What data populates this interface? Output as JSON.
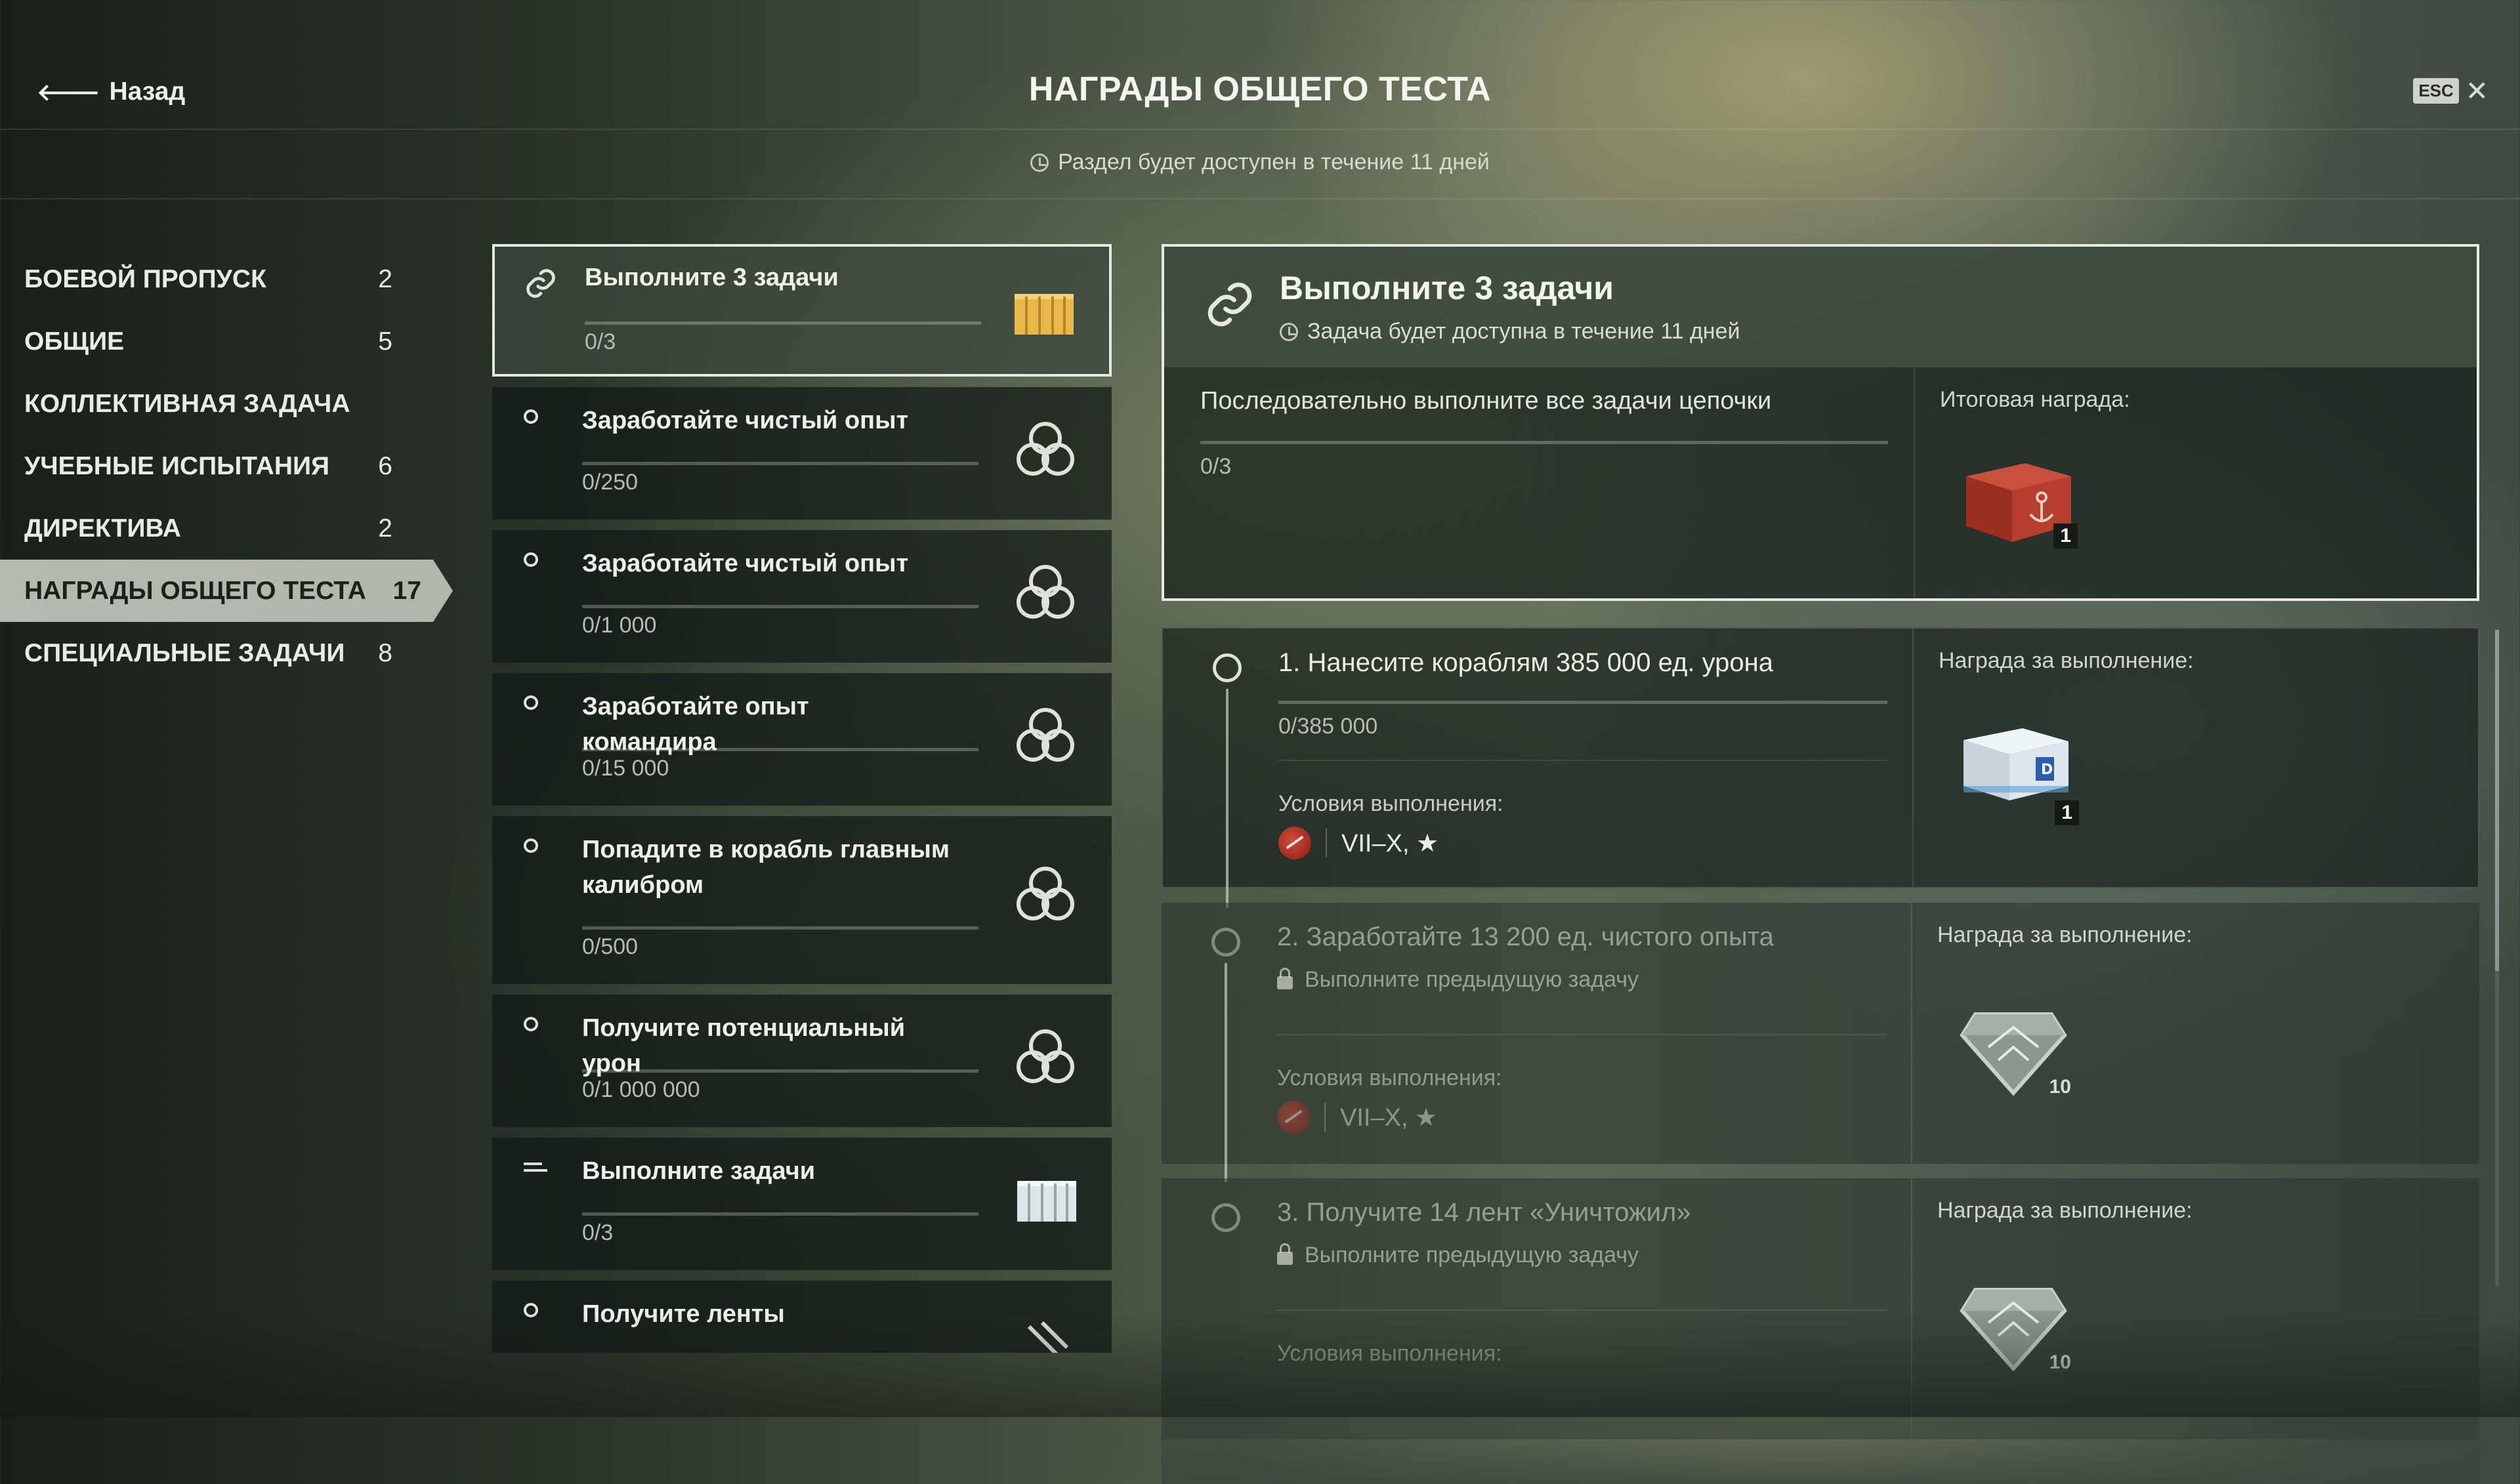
{
  "header": {
    "back_label": "Назад",
    "title": "НАГРАДЫ ОБЩЕГО ТЕСТА",
    "esc_label": "ESC",
    "availability": "Раздел будет доступен в течение 11 дней"
  },
  "sidebar": {
    "items": [
      {
        "label": "БОЕВОЙ ПРОПУСК",
        "count": "2",
        "active": false
      },
      {
        "label": "ОБЩИЕ",
        "count": "5",
        "active": false
      },
      {
        "label": "КОЛЛЕКТИВНАЯ ЗАДАЧА",
        "count": "",
        "active": false
      },
      {
        "label": "УЧЕБНЫЕ ИСПЫТАНИЯ",
        "count": "6",
        "active": false
      },
      {
        "label": "ДИРЕКТИВА",
        "count": "2",
        "active": false
      },
      {
        "label": "НАГРАДЫ ОБЩЕГО ТЕСТА",
        "count": "17",
        "active": true
      },
      {
        "label": "СПЕЦИАЛЬНЫЕ ЗАДАЧИ",
        "count": "8",
        "active": false
      }
    ]
  },
  "tasks": [
    {
      "name": "Выполните 3 задачи",
      "progress": "0/3",
      "status_icon": "chain-link-icon",
      "reward_icon": "golden-container-icon"
    },
    {
      "name": "Заработайте чистый опыт",
      "progress": "0/250",
      "status_icon": "circle-icon",
      "reward_icon": "knot-emblem-icon"
    },
    {
      "name": "Заработайте чистый опыт",
      "progress": "0/1 000",
      "status_icon": "circle-icon",
      "reward_icon": "knot-emblem-icon"
    },
    {
      "name": "Заработайте опыт командира",
      "progress": "0/15 000",
      "status_icon": "circle-icon",
      "reward_icon": "knot-emblem-icon"
    },
    {
      "name": "Попадите в корабль главным калибром",
      "progress": "0/500",
      "status_icon": "circle-icon",
      "reward_icon": "knot-emblem-icon"
    },
    {
      "name": "Получите потенциальный урон",
      "progress": "0/1 000 000",
      "status_icon": "circle-icon",
      "reward_icon": "knot-emblem-icon"
    },
    {
      "name": "Выполните задачи",
      "progress": "0/3",
      "status_icon": "list-icon",
      "reward_icon": "silver-container-icon"
    },
    {
      "name": "Получите ленты",
      "progress": "",
      "status_icon": "circle-icon",
      "reward_icon": "ribbon-icon"
    }
  ],
  "detail": {
    "title": "Выполните 3 задачи",
    "availability": "Задача будет доступна в течение 11 дней",
    "description": "Последовательно выполните все задачи цепочки",
    "progress": "0/3",
    "final_reward_label": "Итоговая награда:",
    "final_reward_qty": "1",
    "steps": [
      {
        "title": "1. Нанесите кораблям 385 000 ед. урона",
        "progress": "0/385 000",
        "locked_text": "",
        "conditions_label": "Условия выполнения:",
        "conditions": "VII–X, ★",
        "reward_label": "Награда за выполнение:",
        "reward_qty": "1",
        "locked": false
      },
      {
        "title": "2. Заработайте 13 200 ед. чистого опыта",
        "progress": "",
        "locked_text": "Выполните предыдущую задачу",
        "conditions_label": "Условия выполнения:",
        "conditions": "VII–X, ★",
        "reward_label": "Награда за выполнение:",
        "reward_qty": "10",
        "locked": true
      },
      {
        "title": "3. Получите 14 лент «Уничтожил»",
        "progress": "",
        "locked_text": "Выполните предыдущую задачу",
        "conditions_label": "Условия выполнения:",
        "conditions": "",
        "reward_label": "Награда за выполнение:",
        "reward_qty": "10",
        "locked": true
      }
    ]
  },
  "colors": {
    "active_border": "#e6e9e2",
    "sidebar_active_bg": "#bec3b9",
    "panel_bg": "#121816",
    "accent_gold": "#e8b84a",
    "accent_red": "#b0392c"
  }
}
